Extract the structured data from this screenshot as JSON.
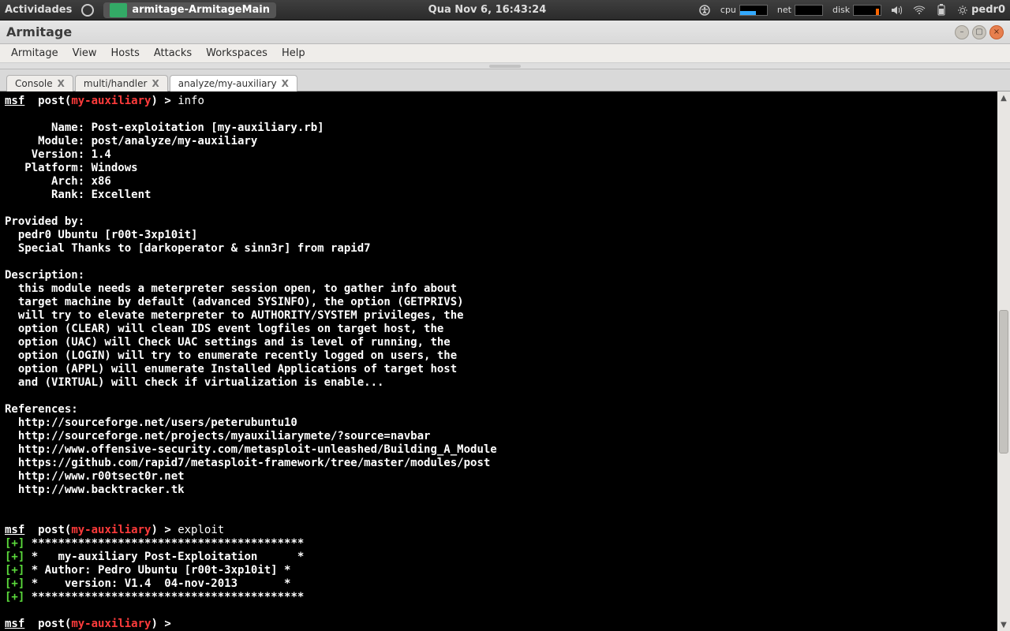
{
  "panel": {
    "activities": "Actividades",
    "task_title": "armitage-ArmitageMain",
    "clock": "Qua Nov  6, 16:43:24",
    "cpu_label": "cpu",
    "net_label": "net",
    "disk_label": "disk",
    "user": "pedr0"
  },
  "window": {
    "title": "Armitage"
  },
  "menu": {
    "items": [
      "Armitage",
      "View",
      "Hosts",
      "Attacks",
      "Workspaces",
      "Help"
    ]
  },
  "tabs": [
    {
      "label": "Console",
      "close": "X",
      "active": false
    },
    {
      "label": "multi/handler",
      "close": "X",
      "active": false
    },
    {
      "label": "analyze/my-auxiliary",
      "close": "X",
      "active": true
    }
  ],
  "prompt": {
    "msf": "msf",
    "post_open": "  post(",
    "module": "my-auxiliary",
    "post_close": ") > "
  },
  "cmds": {
    "info": "info",
    "exploit": "exploit"
  },
  "info": {
    "name_line": "       Name: Post-exploitation [my-auxiliary.rb]",
    "module_line": "     Module: post/analyze/my-auxiliary",
    "version_line": "    Version: 1.4",
    "platform_line": "   Platform: Windows",
    "arch_line": "       Arch: x86",
    "rank_line": "       Rank: Excellent",
    "provided_hdr": "Provided by:",
    "provided_1": "  pedr0 Ubuntu [r00t-3xp10it]",
    "provided_2": "  Special Thanks to [darkoperator & sinn3r] from rapid7",
    "desc_hdr": "Description:",
    "desc_1": "  this module needs a meterpreter session open, to gather info about",
    "desc_2": "  target machine by default (advanced SYSINFO), the option (GETPRIVS)",
    "desc_3": "  will try to elevate meterpreter to AUTHORITY/SYSTEM privileges, the",
    "desc_4": "  option (CLEAR) will clean IDS event logfiles on target host, the",
    "desc_5": "  option (UAC) will Check UAC settings and is level of running, the",
    "desc_6": "  option (LOGIN) will try to enumerate recently logged on users, the",
    "desc_7": "  option (APPL) will enumerate Installed Applications of target host",
    "desc_8": "  and (VIRTUAL) will check if virtualization is enable...",
    "refs_hdr": "References:",
    "ref_1": "  http://sourceforge.net/users/peterubuntu10",
    "ref_2": "  http://sourceforge.net/projects/myauxiliarymete/?source=navbar",
    "ref_3": "  http://www.offensive-security.com/metasploit-unleashed/Building_A_Module",
    "ref_4": "  https://github.com/rapid7/metasploit-framework/tree/master/modules/post",
    "ref_5": "  http://www.r00tsect0r.net",
    "ref_6": "  http://www.backtracker.tk"
  },
  "banner": {
    "plus": "[+]",
    "stars_line": " *****************************************",
    "title_line": " *   my-auxiliary Post-Exploitation      *",
    "author_line": " * Author: Pedro Ubuntu [r00t-3xp10it] *",
    "ver_line": " *    version: V1.4  04-nov-2013       *"
  }
}
